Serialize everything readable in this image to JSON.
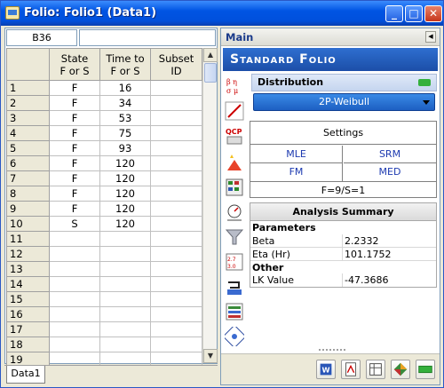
{
  "window": {
    "title": "Folio: Folio1 (Data1)",
    "minimize": "_",
    "maximize": "□",
    "close": "✕"
  },
  "grid": {
    "cell_ref": "B36",
    "formula_value": "",
    "headers": {
      "state": "State\nF or S",
      "time": "Time to\nF or S",
      "subset": "Subset\nID"
    },
    "rows": [
      {
        "n": "1",
        "state": "F",
        "time": "16",
        "subset": ""
      },
      {
        "n": "2",
        "state": "F",
        "time": "34",
        "subset": ""
      },
      {
        "n": "3",
        "state": "F",
        "time": "53",
        "subset": ""
      },
      {
        "n": "4",
        "state": "F",
        "time": "75",
        "subset": ""
      },
      {
        "n": "5",
        "state": "F",
        "time": "93",
        "subset": ""
      },
      {
        "n": "6",
        "state": "F",
        "time": "120",
        "subset": ""
      },
      {
        "n": "7",
        "state": "F",
        "time": "120",
        "subset": ""
      },
      {
        "n": "8",
        "state": "F",
        "time": "120",
        "subset": ""
      },
      {
        "n": "9",
        "state": "F",
        "time": "120",
        "subset": ""
      },
      {
        "n": "10",
        "state": "S",
        "time": "120",
        "subset": ""
      },
      {
        "n": "11",
        "state": "",
        "time": "",
        "subset": ""
      },
      {
        "n": "12",
        "state": "",
        "time": "",
        "subset": ""
      },
      {
        "n": "13",
        "state": "",
        "time": "",
        "subset": ""
      },
      {
        "n": "14",
        "state": "",
        "time": "",
        "subset": ""
      },
      {
        "n": "15",
        "state": "",
        "time": "",
        "subset": ""
      },
      {
        "n": "16",
        "state": "",
        "time": "",
        "subset": ""
      },
      {
        "n": "17",
        "state": "",
        "time": "",
        "subset": ""
      },
      {
        "n": "18",
        "state": "",
        "time": "",
        "subset": ""
      },
      {
        "n": "19",
        "state": "",
        "time": "",
        "subset": ""
      }
    ],
    "sheet_tab": "Data1"
  },
  "panel": {
    "header": "Main",
    "banner": "Standard Folio",
    "distribution_label": "Distribution",
    "distribution_value": "2P-Weibull",
    "settings": {
      "title": "Settings",
      "mle": "MLE",
      "srm": "SRM",
      "fm": "FM",
      "med": "MED",
      "footer": "F=9/S=1"
    },
    "summary": {
      "title": "Analysis Summary",
      "parameters_label": "Parameters",
      "beta_label": "Beta",
      "beta_value": "2.2332",
      "eta_label": "Eta (Hr)",
      "eta_value": "101.1752",
      "other_label": "Other",
      "lk_label": "LK Value",
      "lk_value": "-47.3686"
    },
    "side_icons": [
      "parameters-icon",
      "plot-icon",
      "qcp-icon",
      "wizard-icon",
      "matrix-icon",
      "gauge-icon",
      "filter-icon",
      "batch-icon",
      "transfer-icon",
      "report-icon",
      "wizard-run-icon"
    ],
    "bottom_icons": [
      "word-icon",
      "pdf-icon",
      "sheet-icon",
      "diamond-icon",
      "green-bar-icon"
    ]
  },
  "colors": {
    "accent": "#1d5fc2",
    "title_bar": "#0054e3",
    "green": "#34b03c"
  }
}
